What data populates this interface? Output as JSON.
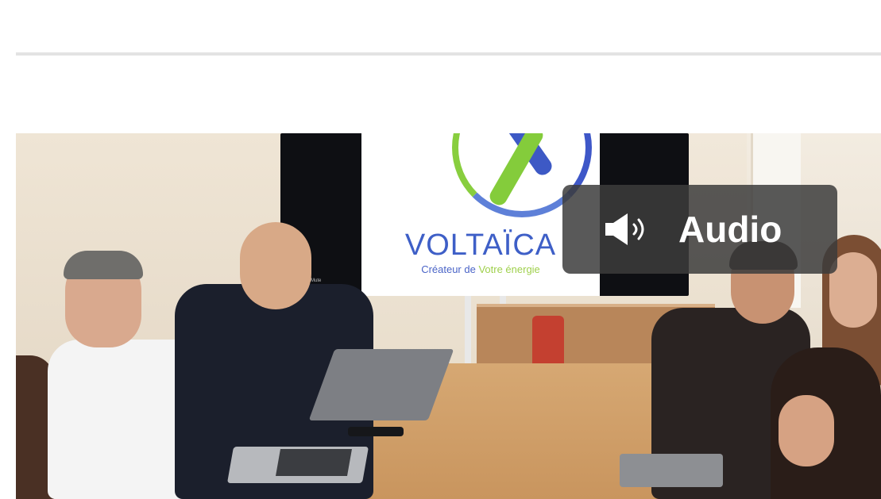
{
  "overlay": {
    "audio_label": "Audio",
    "icon": "speaker-icon"
  },
  "video": {
    "screen": {
      "brand_name": "VOLTAÏCA",
      "tagline_part1": "Créateur de ",
      "tagline_part2": "Votre énergie",
      "call_control": "Mute"
    }
  },
  "colors": {
    "overlay_bg": "#3c3c3c",
    "brand_blue": "#3e5fc7",
    "brand_green": "#88ce3e"
  }
}
